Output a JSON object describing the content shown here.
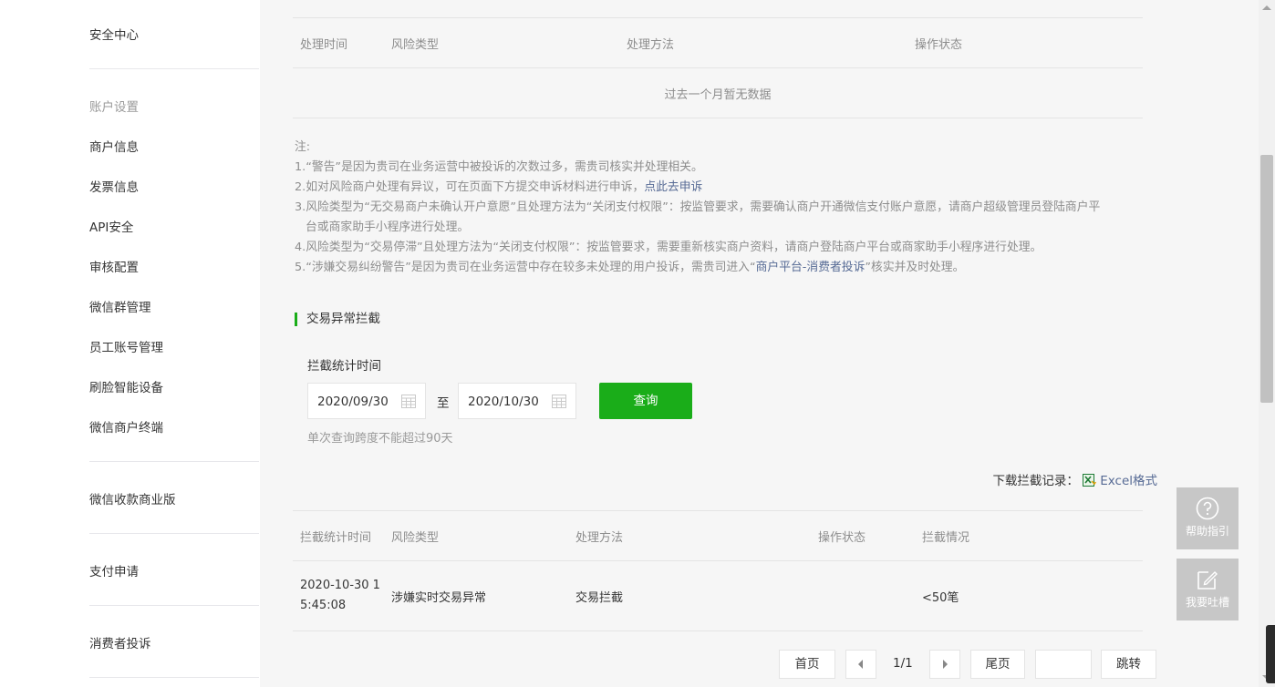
{
  "sidebar": {
    "items": [
      {
        "label": "安全中心"
      },
      {
        "label": "账户设置"
      },
      {
        "label": "商户信息"
      },
      {
        "label": "发票信息"
      },
      {
        "label": "API安全"
      },
      {
        "label": "审核配置"
      },
      {
        "label": "微信群管理"
      },
      {
        "label": "员工账号管理"
      },
      {
        "label": "刷脸智能设备"
      },
      {
        "label": "微信商户终端"
      },
      {
        "label": "微信收款商业版"
      },
      {
        "label": "支付申请"
      },
      {
        "label": "消费者投诉"
      }
    ]
  },
  "risk_table": {
    "headers": [
      "处理时间",
      "风险类型",
      "处理方法",
      "操作状态"
    ],
    "empty_text": "过去一个月暂无数据"
  },
  "notes": {
    "title": "注:",
    "line1": "1.“警告”是因为贵司在业务运营中被投诉的次数过多，需贵司核实并处理相关。",
    "line2_text": "2.如对风险商户处理有异议，可在页面下方提交申诉材料进行申诉，",
    "line2_link": "点此去申诉",
    "line3a": "3.风险类型为“无交易商户未确认开户意愿”且处理方法为“关闭支付权限”：按监管要求，需要确认商户开通微信支付账户意愿，请商户超级管理员登陆商户平",
    "line3b": "台或商家助手小程序进行处理。",
    "line4": "4.风险类型为“交易停滞”且处理方法为“关闭支付权限”：按监管要求，需要重新核实商户资料，请商户登陆商户平台或商家助手小程序进行处理。",
    "line5_pre": "5.“涉嫌交易纠纷警告”是因为贵司在业务运营中存在较多未处理的用户投诉，需贵司进入“",
    "line5_link": "商户平台-消费者投诉",
    "line5_post": "”核实并及时处理。"
  },
  "intercept": {
    "section_title": "交易异常拦截",
    "time_label": "拦截统计时间",
    "start_date": "2020/09/30",
    "separator": "至",
    "end_date": "2020/10/30",
    "query_button": "查询",
    "hint": "单次查询跨度不能超过90天",
    "download_label": "下载拦截记录：",
    "download_link": "Excel格式",
    "table": {
      "headers": [
        "拦截统计时间",
        "风险类型",
        "处理方法",
        "操作状态",
        "拦截情况"
      ],
      "rows": [
        {
          "time_l1": "2020-10-30 1",
          "time_l2": "5:45:08",
          "type": "涉嫌实时交易异常",
          "method": "交易拦截",
          "status": "",
          "result": "<50笔"
        }
      ]
    }
  },
  "pagination": {
    "first": "首页",
    "prev_icon": "chevron-left-icon",
    "page_info": "1/1",
    "next_icon": "chevron-right-icon",
    "last": "尾页",
    "jump_value": "",
    "jump_button": "跳转"
  },
  "float_buttons": {
    "help": "帮助指引",
    "feedback": "我要吐槽"
  },
  "colors": {
    "accent_green": "#1aad19",
    "link_blue": "#576b95",
    "muted_text": "#8d8d8d",
    "float_gray": "#c7c7c7"
  }
}
